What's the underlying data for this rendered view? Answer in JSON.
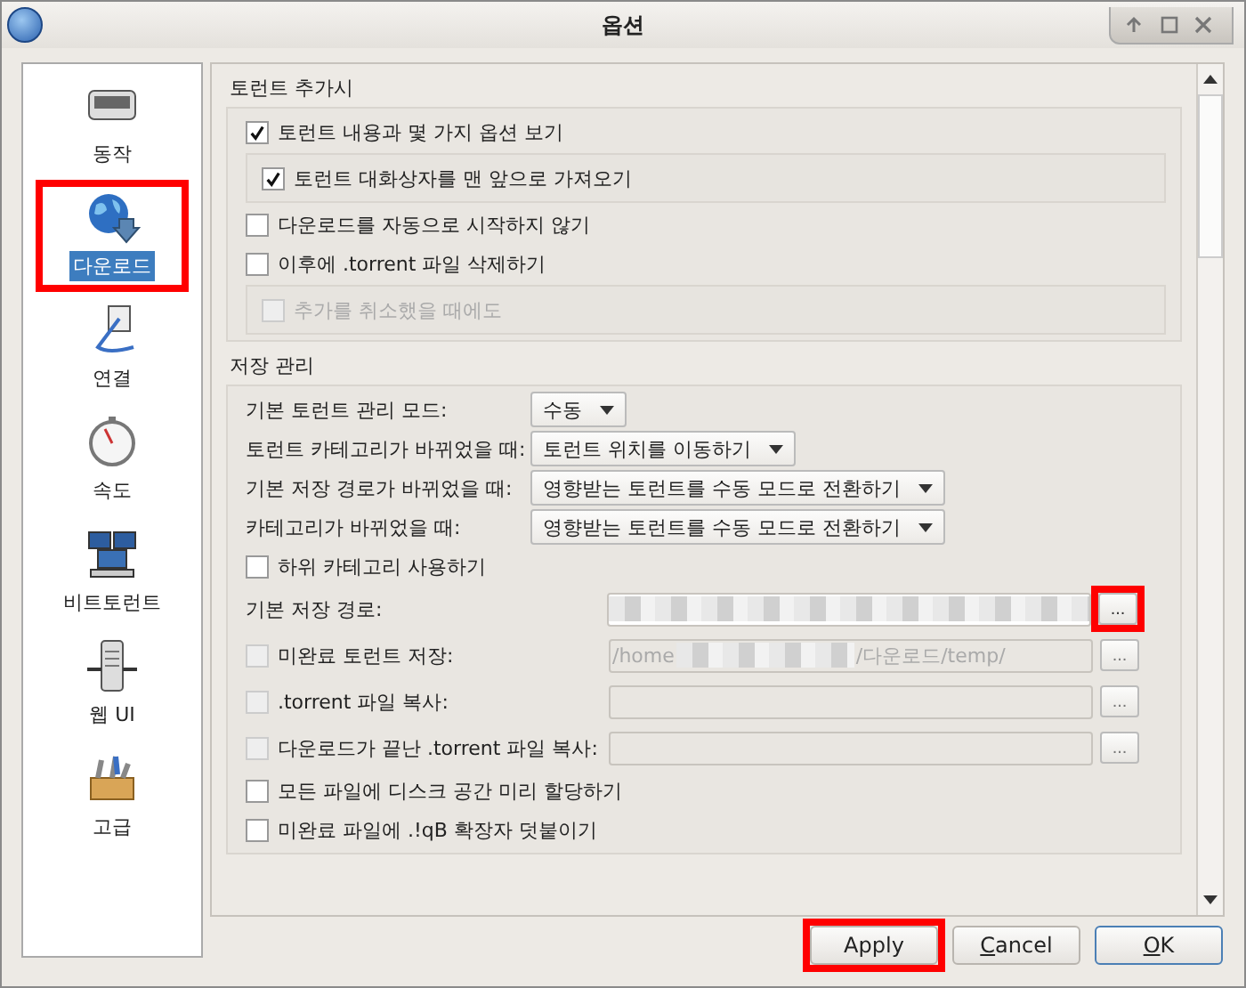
{
  "window": {
    "title": "옵션"
  },
  "sidebar": {
    "items": [
      {
        "label": "동작",
        "selected": false,
        "highlighted": false
      },
      {
        "label": "다운로드",
        "selected": true,
        "highlighted": true
      },
      {
        "label": "연결",
        "selected": false,
        "highlighted": false
      },
      {
        "label": "속도",
        "selected": false,
        "highlighted": false
      },
      {
        "label": "비트토런트",
        "selected": false,
        "highlighted": false
      },
      {
        "label": "웹 UI",
        "selected": false,
        "highlighted": false
      },
      {
        "label": "고급",
        "selected": false,
        "highlighted": false
      }
    ]
  },
  "sections": [
    {
      "title": "토런트 추가시",
      "rows": [
        {
          "kind": "check",
          "label": "토런트 내용과 몇 가지 옵션 보기",
          "checked": true,
          "disabled": false
        },
        {
          "kind": "group",
          "rows": [
            {
              "kind": "check",
              "label": "토런트 대화상자를 맨 앞으로 가져오기",
              "checked": true,
              "disabled": false
            }
          ]
        },
        {
          "kind": "check",
          "label": "다운로드를 자동으로 시작하지 않기",
          "checked": false,
          "disabled": false
        },
        {
          "kind": "check",
          "label": "이후에 .torrent 파일 삭제하기",
          "checked": false,
          "disabled": false
        },
        {
          "kind": "group",
          "rows": [
            {
              "kind": "check",
              "label": "추가를 취소했을 때에도",
              "checked": false,
              "disabled": true
            }
          ]
        }
      ]
    },
    {
      "title": "저장 관리",
      "rows": [
        {
          "kind": "combo",
          "label": "기본 토런트 관리 모드:",
          "value": "수동"
        },
        {
          "kind": "combo",
          "label": "토런트 카테고리가 바뀌었을 때:",
          "value": "토런트 위치를 이동하기"
        },
        {
          "kind": "combo",
          "label": "기본 저장 경로가 바뀌었을 때:",
          "value": "영향받는 토런트를 수동 모드로 전환하기"
        },
        {
          "kind": "combo",
          "label": "카테고리가 바뀌었을 때:",
          "value": "영향받는 토런트를 수동 모드로 전환하기"
        },
        {
          "kind": "check",
          "label": "하위 카테고리 사용하기",
          "checked": false,
          "disabled": false
        },
        {
          "kind": "path",
          "label": "기본 저장 경로:",
          "disabled": false,
          "highlighted": true,
          "browse": "...",
          "segments": [
            {
              "kind": "redacted"
            }
          ]
        },
        {
          "kind": "check_path",
          "label": "미완료 토런트 저장:",
          "checked": false,
          "disabled": true,
          "highlighted": false,
          "browse": "...",
          "segments": [
            {
              "kind": "text",
              "text": "/home"
            },
            {
              "kind": "redacted"
            },
            {
              "kind": "text",
              "text": "/다운로드/temp/"
            }
          ]
        },
        {
          "kind": "check_path",
          "label": ".torrent 파일 복사:",
          "checked": false,
          "disabled": true,
          "highlighted": false,
          "browse": "...",
          "segments": []
        },
        {
          "kind": "check_path",
          "label": "다운로드가 끝난 .torrent 파일 복사:",
          "checked": false,
          "disabled": true,
          "highlighted": false,
          "browse": "...",
          "segments": []
        },
        {
          "kind": "check",
          "label": "모든 파일에 디스크 공간 미리 할당하기",
          "checked": false,
          "disabled": false
        },
        {
          "kind": "check",
          "label": "미완료 파일에 .!qB 확장자 덧붙이기",
          "checked": false,
          "disabled": false
        }
      ]
    }
  ],
  "buttons": [
    {
      "label": "Apply",
      "mnemonic": false,
      "default": false,
      "highlighted": true
    },
    {
      "label": "Cancel",
      "mnemonic": true,
      "default": false,
      "highlighted": false
    },
    {
      "label": "OK",
      "mnemonic": true,
      "default": true,
      "highlighted": false
    }
  ]
}
